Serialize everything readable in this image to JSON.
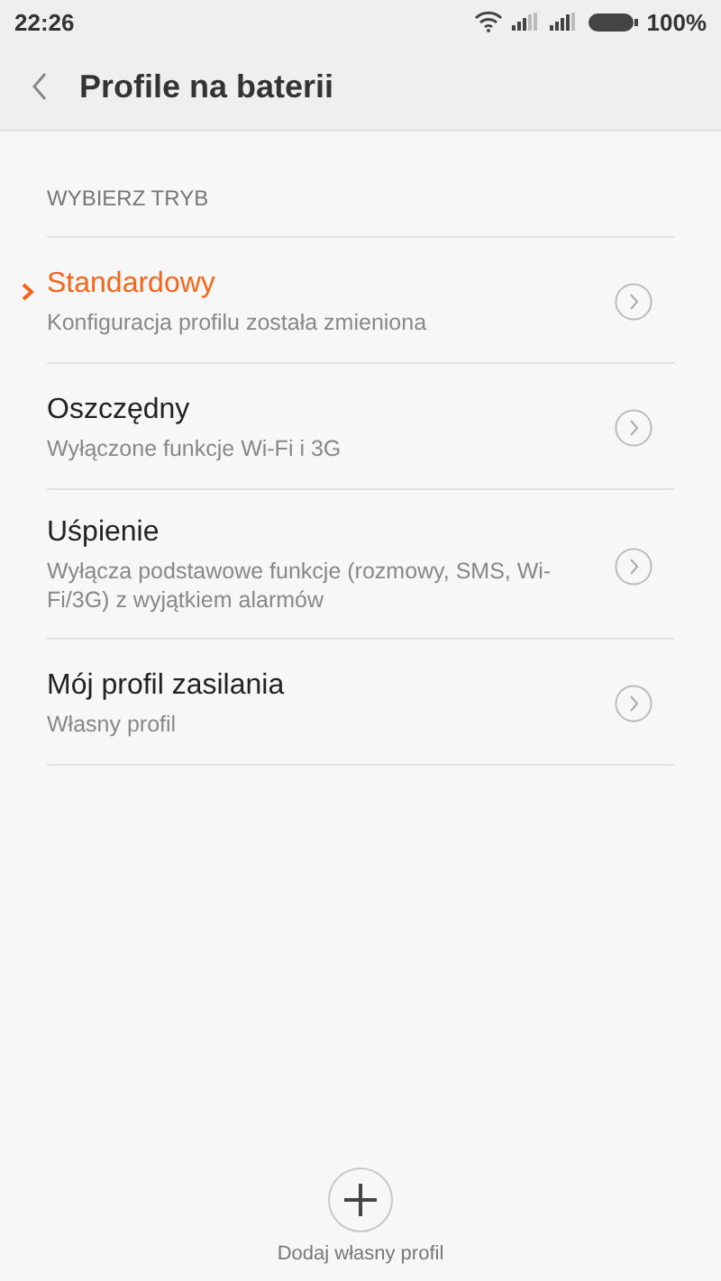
{
  "status_bar": {
    "time": "22:26",
    "battery": "100%"
  },
  "header": {
    "title": "Profile na baterii"
  },
  "section": {
    "label": "WYBIERZ TRYB"
  },
  "profiles": [
    {
      "title": "Standardowy",
      "subtitle": "Konfiguracja profilu została zmieniona",
      "selected": true
    },
    {
      "title": "Oszczędny",
      "subtitle": "Wyłączone funkcje Wi-Fi i 3G",
      "selected": false
    },
    {
      "title": "Uśpienie",
      "subtitle": "Wyłącza podstawowe funkcje (rozmowy, SMS, Wi-Fi/3G) z wyjątkiem alarmów",
      "selected": false
    },
    {
      "title": "Mój profil zasilania",
      "subtitle": "Własny profil",
      "selected": false
    }
  ],
  "add_button": {
    "label": "Dodaj własny profil"
  }
}
